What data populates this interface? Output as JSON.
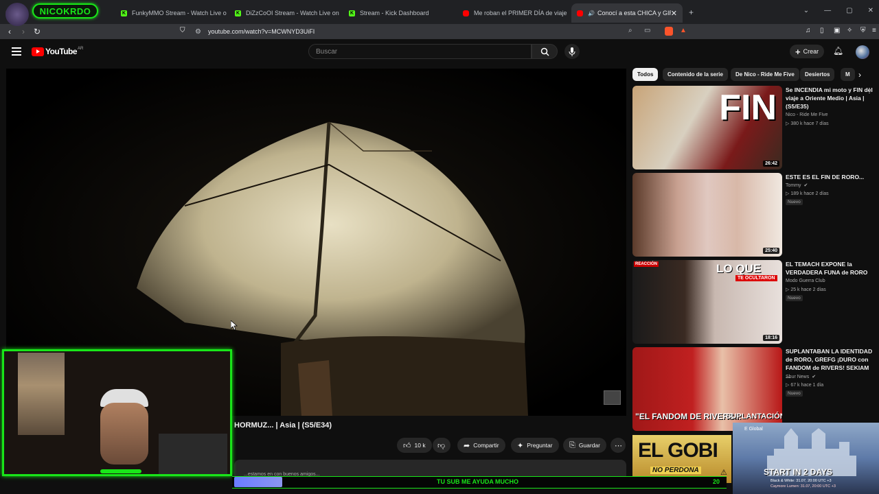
{
  "browser": {
    "tabs": [
      {
        "label": "",
        "icon": "kick"
      },
      {
        "label": "FunkyMMO Stream - Watch Live on",
        "icon": "kick"
      },
      {
        "label": "DiZzCoOI Stream - Watch Live on Kic",
        "icon": "kick"
      },
      {
        "label": "Stream - Kick Dashboard",
        "icon": "kick"
      },
      {
        "label": "Me roban el PRIMER DÍA de viaje | A",
        "icon": "youtube"
      },
      {
        "label": "Conocí a esta CHICA y GIRO",
        "icon": "youtube",
        "active": true
      }
    ],
    "url": "youtube.com/watch?v=MCWNYD3UiFI"
  },
  "youtube": {
    "logo_text": "YouTube",
    "country": "AR",
    "search_placeholder": "Buscar",
    "create_label": "Crear"
  },
  "video": {
    "title": "HORMUZ... | Asia | (S5/E34)",
    "likes": "10 k",
    "share_label": "Compartir",
    "ask_label": "Preguntar",
    "save_label": "Guardar",
    "description_snippet": "...estamos en con buenos amigos..."
  },
  "chips": [
    "Todos",
    "Contenido de la serie",
    "De Nico - Ride Me Five",
    "Desiertos",
    "M"
  ],
  "recommended": [
    {
      "title": "Se INCENDIA mi moto y FIN del viaje a Oriente Medio | Asia | (S5/E35)",
      "channel": "Nico - Ride Me Five",
      "stats": "▷ 380 k  hace 7 días",
      "duration": "26:42",
      "thumb_text": "FIN",
      "badge": ""
    },
    {
      "title": "ESTE ES EL FIN DE RORO...",
      "channel": "Tommy",
      "stats": "▷ 189 k  hace 2 días",
      "duration": "25:40",
      "thumb_text": "",
      "badge": "Nuevo"
    },
    {
      "title": "EL TEMACH EXPONE la VERDADERA FUNA de RORO",
      "channel": "Modo Guerra Club",
      "stats": "▷ 25 k  hace 2 días",
      "duration": "18:16",
      "thumb_text": "LO QUE",
      "thumb_sub": "TE OCULTARON",
      "thumb_tag": "REACCIÓN",
      "badge": "Nuevo"
    },
    {
      "title": "SUPLANTABAN LA IDENTIDAD de RORO, GREFG ¡DURO con FANDOM de RIVERS! SEKIAM ...",
      "channel": "Shur News",
      "stats": "▷ 67 k  hace 1 día",
      "duration": "",
      "thumb_text": "\"EL FANDOM DE RIVERS...",
      "thumb_sub": "SUPLANTACIÓN DE",
      "badge": "Nuevo"
    }
  ],
  "overlay": {
    "streamer_name": "NICOKRDO",
    "sub_message": "TU SUB ME AYUDA MUCHO",
    "sub_count": "20",
    "sub_progress": 0.1,
    "ad_brand": "E Global",
    "ad_title": "START IN 2 DAYS",
    "ad_line1": "Black & White: 31.07, 20:00 UTC +3",
    "ad_line2": "Caymore Lumen: 31.07, 20:00 UTC +3",
    "promo_text": "EL GOBI",
    "promo_sub": "NO PERDONA"
  },
  "colors": {
    "accent_green": "#19e619",
    "yt_red": "#ff0000"
  }
}
